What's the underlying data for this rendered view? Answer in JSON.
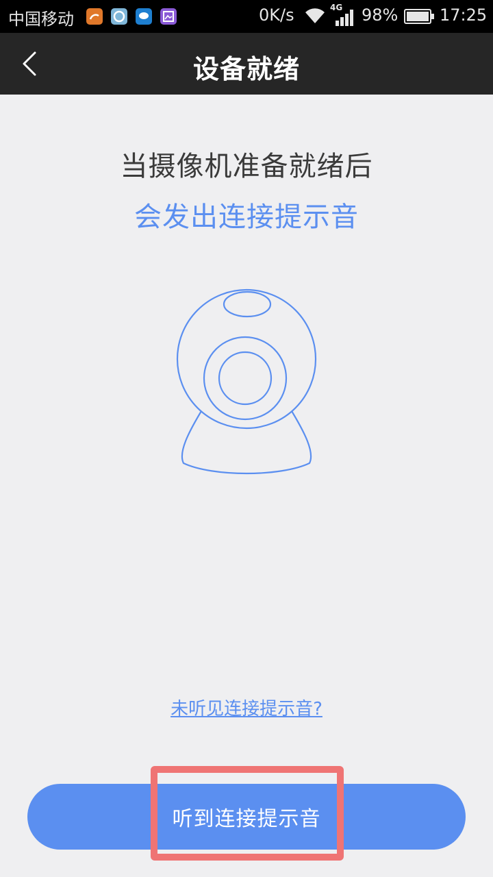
{
  "status_bar": {
    "carrier": "中国移动",
    "network_speed": "0K/s",
    "network_type": "4G",
    "battery": "98%",
    "time": "17:25",
    "app_icons": [
      "uc-browser-icon",
      "browser-icon",
      "chat-icon",
      "gallery-icon"
    ]
  },
  "header": {
    "title": "设备就绪"
  },
  "main": {
    "line1": "当摄像机准备就绪后",
    "line2": "会发出连接提示音",
    "help_link": "未听见连接提示音?",
    "primary_button": "听到连接提示音"
  },
  "colors": {
    "accent": "#5b8ff0",
    "header_bg": "#262626",
    "page_bg": "#efeff1",
    "highlight": "#ef7474"
  }
}
